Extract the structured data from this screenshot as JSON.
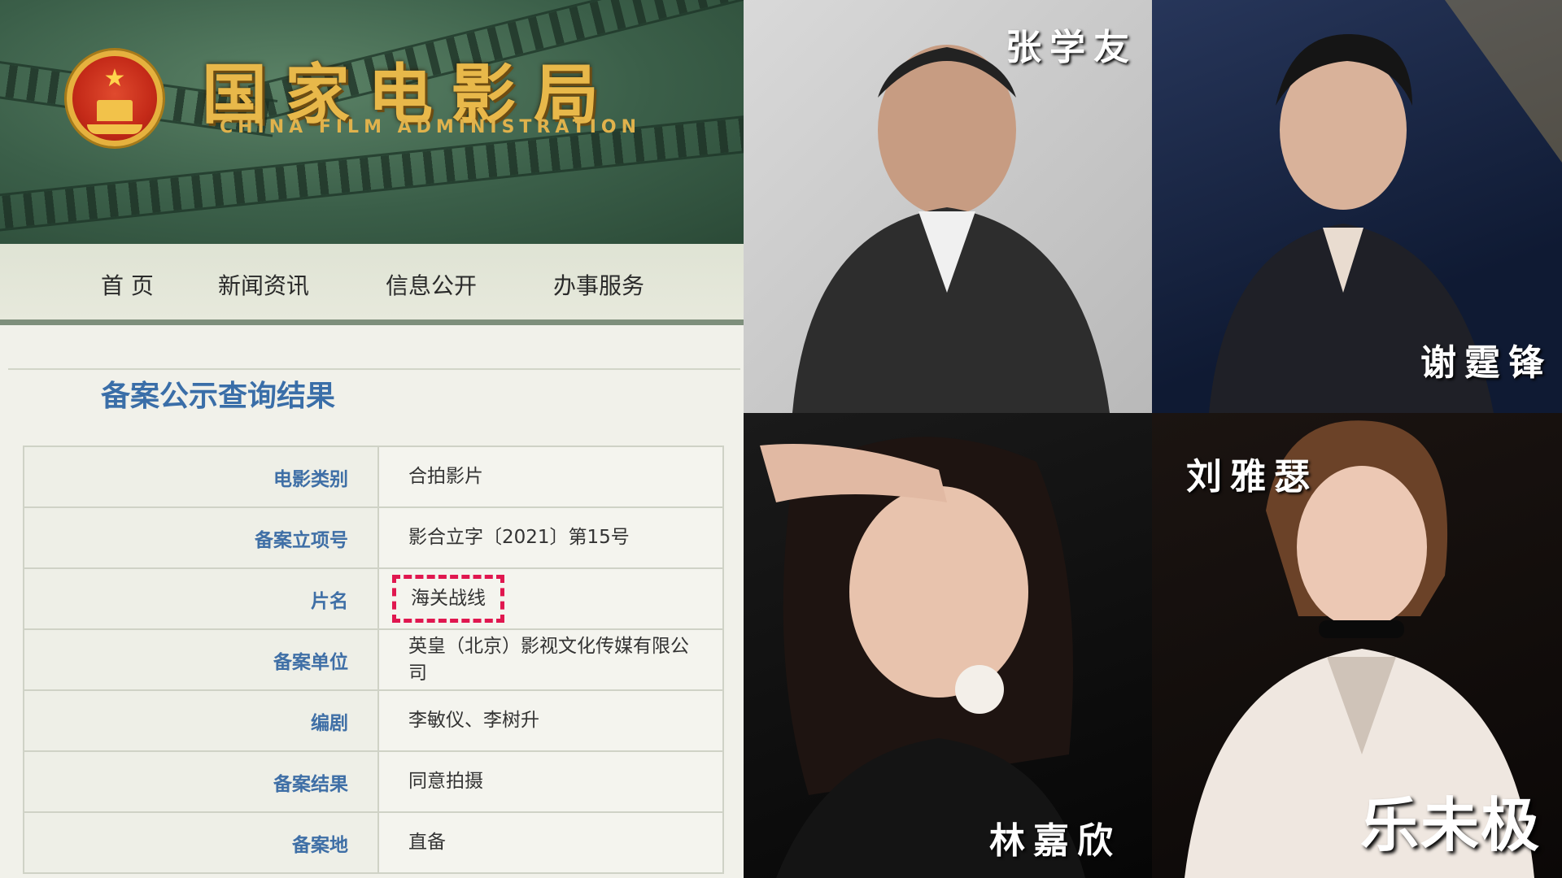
{
  "banner": {
    "title_cn": "国家电影局",
    "title_en": "CHINA FILM ADMINISTRATION"
  },
  "nav": {
    "items": [
      "首 页",
      "新闻资讯",
      "信息公开",
      "办事服务"
    ]
  },
  "section_title": "备案公示查询结果",
  "record": [
    {
      "key": "电影类别",
      "value": "合拍影片"
    },
    {
      "key": "备案立项号",
      "value": "影合立字〔2021〕第15号"
    },
    {
      "key": "片名",
      "value": "海关战线"
    },
    {
      "key": "备案单位",
      "value": "英皇（北京）影视文化传媒有限公司"
    },
    {
      "key": "编剧",
      "value": "李敏仪、李树升"
    },
    {
      "key": "备案结果",
      "value": "同意拍摄"
    },
    {
      "key": "备案地",
      "value": "直备"
    }
  ],
  "cast": [
    {
      "name": "张学友"
    },
    {
      "name": "谢霆锋"
    },
    {
      "name": "林嘉欣"
    },
    {
      "name": "刘雅瑟"
    }
  ],
  "watermark": "乐未极",
  "colors": {
    "banner_green": "#3b5f49",
    "gold": "#e8b84a",
    "title_blue": "#3a6ea8",
    "highlight_red": "#e0174f"
  }
}
